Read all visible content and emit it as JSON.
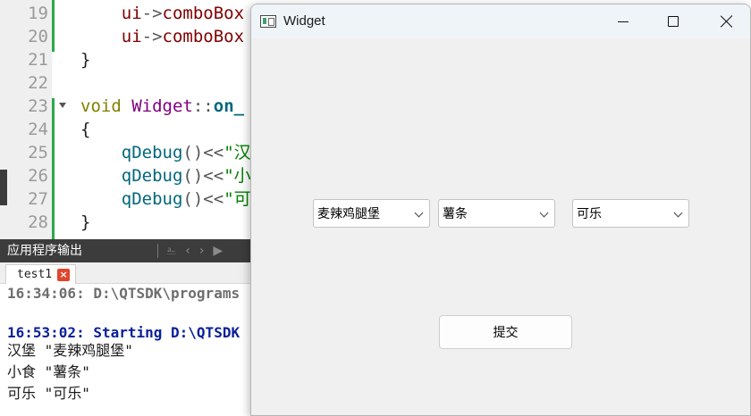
{
  "editor": {
    "lines": [
      {
        "num": "19",
        "parts": [
          {
            "t": "    ",
            "c": ""
          },
          {
            "t": "ui",
            "c": "var"
          },
          {
            "t": "->",
            "c": "op"
          },
          {
            "t": "comboBox",
            "c": "var"
          }
        ]
      },
      {
        "num": "20",
        "parts": [
          {
            "t": "    ",
            "c": ""
          },
          {
            "t": "ui",
            "c": "var"
          },
          {
            "t": "->",
            "c": "op"
          },
          {
            "t": "comboBox",
            "c": "var"
          }
        ]
      },
      {
        "num": "21",
        "parts": [
          {
            "t": "}",
            "c": ""
          }
        ]
      },
      {
        "num": "22",
        "parts": []
      },
      {
        "num": "23",
        "parts": [
          {
            "t": "void",
            "c": "kw"
          },
          {
            "t": " ",
            "c": ""
          },
          {
            "t": "Widget",
            "c": "cls"
          },
          {
            "t": "::",
            "c": "op"
          },
          {
            "t": "on_",
            "c": "fnb"
          }
        ]
      },
      {
        "num": "24",
        "parts": [
          {
            "t": "{",
            "c": ""
          }
        ]
      },
      {
        "num": "25",
        "parts": [
          {
            "t": "    ",
            "c": ""
          },
          {
            "t": "qDebug",
            "c": "fn"
          },
          {
            "t": "()",
            "c": "op"
          },
          {
            "t": "<<",
            "c": "op"
          },
          {
            "t": "\"汉",
            "c": "str"
          }
        ]
      },
      {
        "num": "26",
        "parts": [
          {
            "t": "    ",
            "c": ""
          },
          {
            "t": "qDebug",
            "c": "fn"
          },
          {
            "t": "()",
            "c": "op"
          },
          {
            "t": "<<",
            "c": "op"
          },
          {
            "t": "\"小",
            "c": "str"
          }
        ]
      },
      {
        "num": "27",
        "parts": [
          {
            "t": "    ",
            "c": ""
          },
          {
            "t": "qDebug",
            "c": "fn"
          },
          {
            "t": "()",
            "c": "op"
          },
          {
            "t": "<<",
            "c": "op"
          },
          {
            "t": "\"可",
            "c": "str"
          }
        ]
      },
      {
        "num": "28",
        "parts": [
          {
            "t": "}",
            "c": ""
          }
        ]
      }
    ]
  },
  "output": {
    "header_label": "应用程序输出",
    "tab_label": "test1",
    "tab_close": "×",
    "lines": [
      {
        "text": "16:34:06: D:\\QTSDK\\programs",
        "style": "out-gray"
      },
      {
        "text": "",
        "style": "out-plain"
      },
      {
        "text": "16:53:02: Starting D:\\QTSDK",
        "style": "out-blue"
      },
      {
        "text": "汉堡 \"麦辣鸡腿堡\"",
        "style": "out-plain"
      },
      {
        "text": "小食 \"薯条\"",
        "style": "out-plain"
      },
      {
        "text": "可乐 \"可乐\"",
        "style": "out-plain"
      }
    ]
  },
  "window": {
    "title": "Widget",
    "combo1_value": "麦辣鸡腿堡",
    "combo2_value": "薯条",
    "combo3_value": "可乐",
    "submit_label": "提交"
  },
  "colors": {
    "change_marker": "#2ba84a",
    "titlebar_bg": "#eff4f9",
    "client_bg": "#f0f0f0"
  }
}
